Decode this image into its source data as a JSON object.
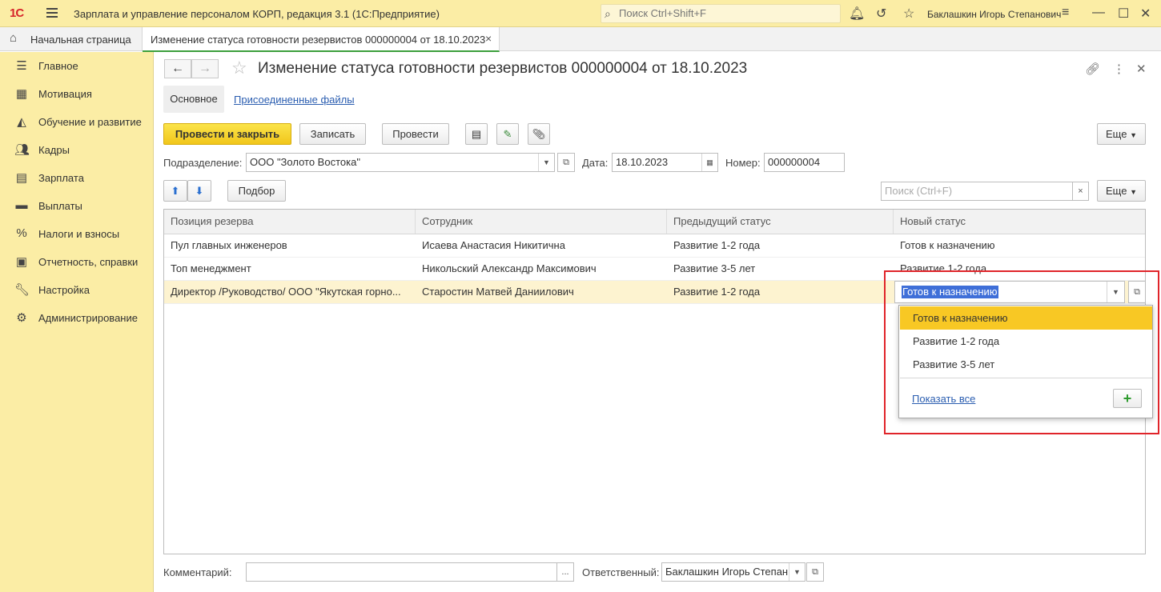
{
  "app": {
    "logo": "1С",
    "title": "Зарплата и управление персоналом КОРП, редакция 3.1  (1С:Предприятие)",
    "search_placeholder": "Поиск Ctrl+Shift+F",
    "user": "Баклашкин Игорь Степанович"
  },
  "tabs": {
    "home": "Начальная страница",
    "doc": "Изменение статуса готовности резервистов 000000004 от 18.10.2023",
    "close": "×"
  },
  "sidebar": {
    "items": [
      {
        "label": "Главное",
        "icon": "menu-icon"
      },
      {
        "label": "Мотивация",
        "icon": "gift-icon"
      },
      {
        "label": "Обучение и развитие",
        "icon": "graduation-cap-icon"
      },
      {
        "label": "Кадры",
        "icon": "people-icon"
      },
      {
        "label": "Зарплата",
        "icon": "calculator-icon"
      },
      {
        "label": "Выплаты",
        "icon": "wallet-icon"
      },
      {
        "label": "Налоги и взносы",
        "icon": "percent-icon"
      },
      {
        "label": "Отчетность, справки",
        "icon": "report-icon"
      },
      {
        "label": "Настройка",
        "icon": "wrench-icon"
      },
      {
        "label": "Администрирование",
        "icon": "gear-icon"
      }
    ]
  },
  "document": {
    "title": "Изменение статуса готовности резервистов 000000004 от 18.10.2023",
    "subtabs": {
      "main": "Основное",
      "files": "Присоединенные файлы"
    },
    "toolbar": {
      "post_close": "Провести и закрыть",
      "save": "Записать",
      "post": "Провести",
      "more": "Еще"
    },
    "fields": {
      "department_label": "Подразделение:",
      "department_value": "ООО \"Золото Востока\"",
      "date_label": "Дата:",
      "date_value": "18.10.2023",
      "number_label": "Номер:",
      "number_value": "000000004"
    },
    "table_toolbar": {
      "pick": "Подбор",
      "search_placeholder": "Поиск (Ctrl+F)",
      "clear": "×",
      "more": "Еще"
    },
    "table": {
      "columns": [
        "Позиция резерва",
        "Сотрудник",
        "Предыдущий статус",
        "Новый статус"
      ],
      "rows": [
        [
          "Пул главных инженеров",
          "Исаева Анастасия Никитична",
          "Развитие 1-2 года",
          "Готов к назначению"
        ],
        [
          "Топ менеджмент",
          "Никольский Александр Максимович",
          "Развитие 3-5 лет",
          "Развитие 1-2 года"
        ],
        [
          "Директор /Руководство/ ООО \"Якутская горно...",
          "Старостин Матвей Даниилович",
          "Развитие 1-2 года",
          "Готов к назначению"
        ]
      ],
      "selected_row": 2
    },
    "dropdown": {
      "options": [
        "Готов к назначению",
        "Развитие 1-2 года",
        "Развитие 3-5 лет"
      ],
      "highlighted": 0,
      "show_all": "Показать все",
      "add": "+"
    },
    "footer": {
      "comment_label": "Комментарий:",
      "comment_value": "",
      "ellipsis": "...",
      "responsible_label": "Ответственный:",
      "responsible_value": "Баклашкин Игорь Степан"
    }
  },
  "colors": {
    "panel_yellow": "#fbeda5",
    "primary_button": "#f1c61b",
    "highlight_red": "#e0242a",
    "link_blue": "#2a5db0",
    "selection_blue": "#3f6fd8"
  }
}
